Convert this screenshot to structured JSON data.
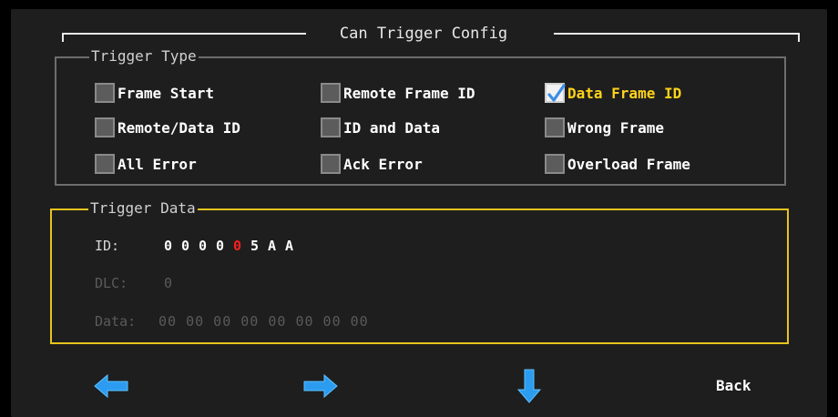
{
  "title": "Can Trigger Config",
  "trigger_type": {
    "legend": "Trigger Type",
    "options": [
      {
        "label": "Frame Start",
        "checked": false
      },
      {
        "label": "Remote Frame ID",
        "checked": false
      },
      {
        "label": "Data Frame ID",
        "checked": true
      },
      {
        "label": "Remote/Data ID",
        "checked": false
      },
      {
        "label": "ID and Data",
        "checked": false
      },
      {
        "label": "Wrong Frame",
        "checked": false
      },
      {
        "label": "All Error",
        "checked": false
      },
      {
        "label": "Ack Error",
        "checked": false
      },
      {
        "label": "Overload Frame",
        "checked": false
      }
    ]
  },
  "trigger_data": {
    "legend": "Trigger Data",
    "id_label": "ID:",
    "id_digits": [
      "0",
      "0",
      "0",
      "0",
      "0",
      "5",
      "A",
      "A"
    ],
    "id_cursor_index": 4,
    "dlc_label": "DLC:",
    "dlc_value": "0",
    "data_label": "Data:",
    "data_value": "00 00 00 00 00 00 00 00"
  },
  "nav": {
    "back_label": "Back"
  },
  "colors": {
    "background": "#1e1e1e",
    "accent": "#ffd21a",
    "group_border_active": "#e6c41e",
    "cursor_digit": "#ff1e1e",
    "arrow": "#2b9cf0"
  }
}
